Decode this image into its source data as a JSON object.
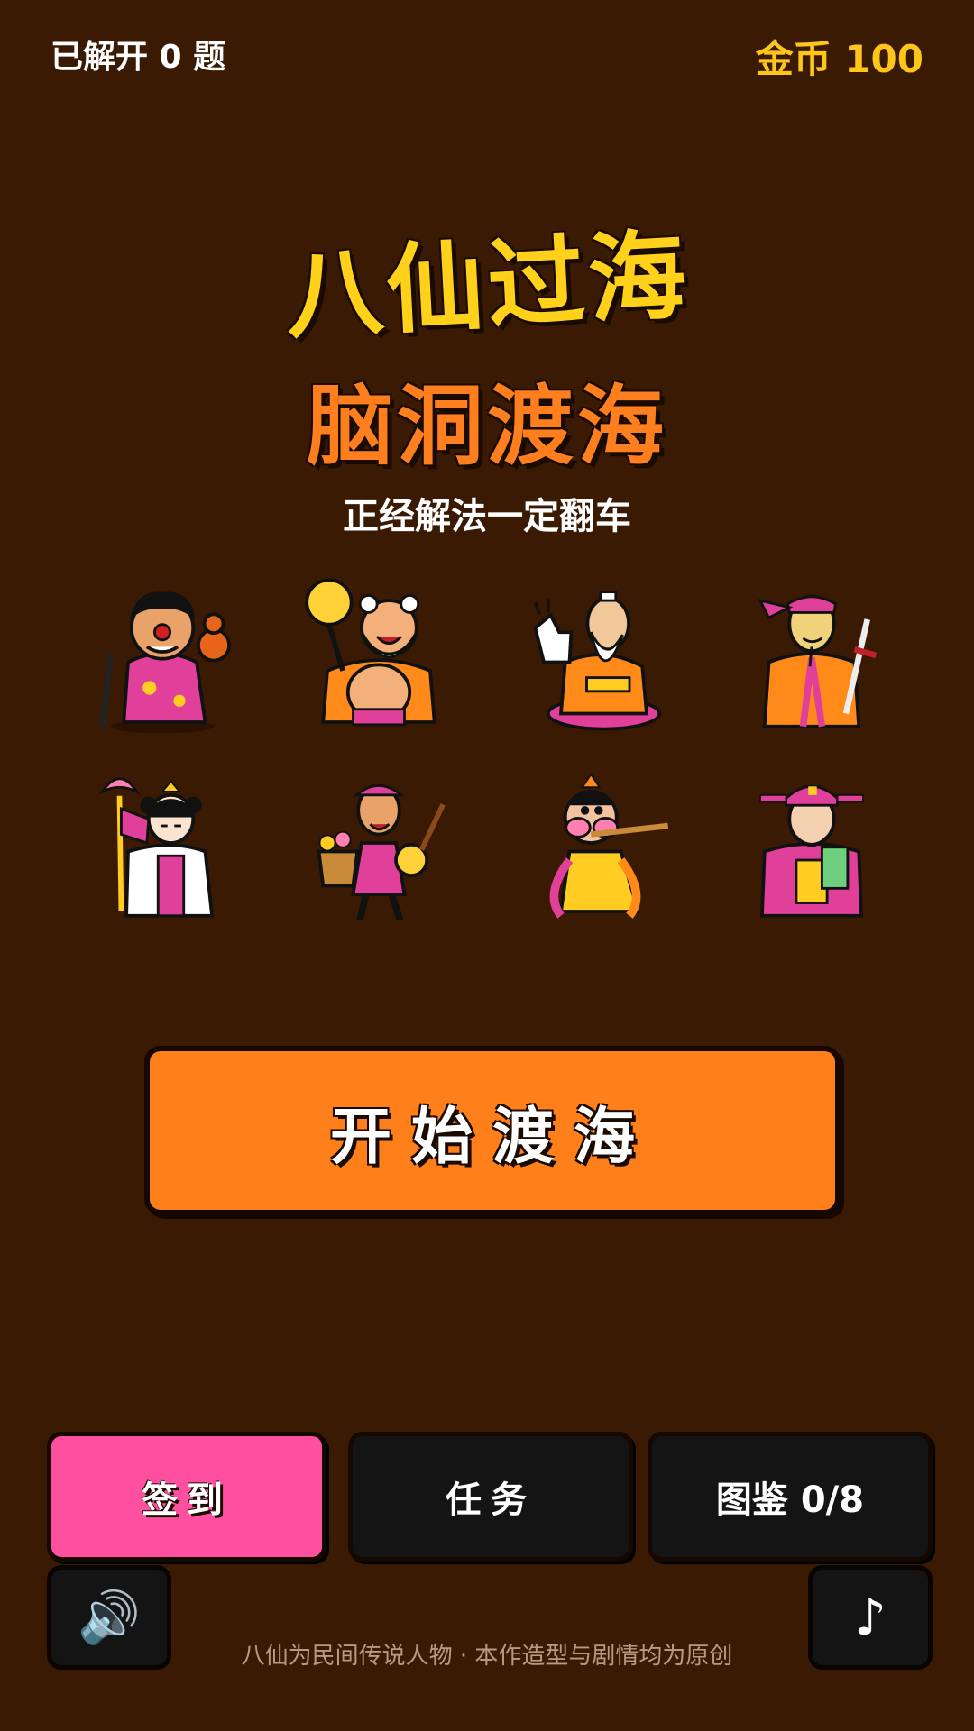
{
  "status": {
    "unlocked": "已解开 0 题",
    "coins": "金币 100"
  },
  "title": {
    "main": "八仙过海",
    "sub": "脑洞渡海",
    "tagline": "正经解法一定翻车"
  },
  "characters": [
    {
      "icon": "tieguaili-character-icon"
    },
    {
      "icon": "hanzhongli-character-icon"
    },
    {
      "icon": "zhangguolao-character-icon"
    },
    {
      "icon": "lvdongbin-character-icon"
    },
    {
      "icon": "hexiangu-character-icon"
    },
    {
      "icon": "lancaihe-character-icon"
    },
    {
      "icon": "hanxiangzi-character-icon"
    },
    {
      "icon": "caoguojiu-character-icon"
    }
  ],
  "buttons": {
    "start": "开始渡海",
    "checkin": "签到",
    "tasks": "任务",
    "album": "图鉴 0/8",
    "sound_icon": "🔊",
    "music_icon": "♪"
  },
  "footer": "八仙为民间传说人物 · 本作造型与剧情均为原创",
  "colors": {
    "background": "#3a1a03",
    "title_yellow": "#ffd11a",
    "title_orange": "#ff7f1f",
    "start_button": "#ff7f1a",
    "checkin_button": "#ff4fa0",
    "dark_button": "#141414",
    "coin_gold": "#ffc61a"
  }
}
